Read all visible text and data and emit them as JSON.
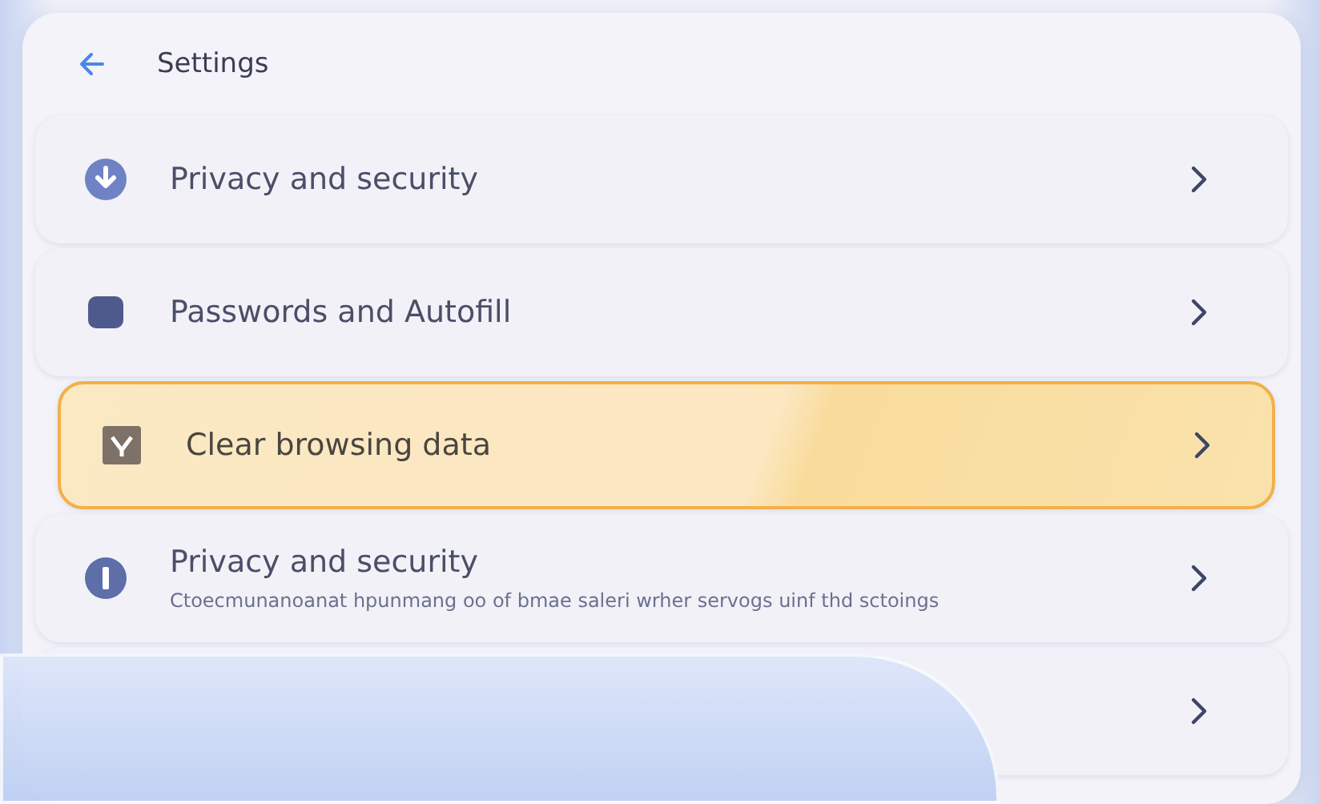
{
  "header": {
    "title": "Settings"
  },
  "items": [
    {
      "kind": "download",
      "label": "Privacy and security",
      "selected": false
    },
    {
      "kind": "square",
      "label": "Passwords and Autofill",
      "selected": false
    },
    {
      "kind": "broom",
      "label": "Clear browsing data",
      "selected": true
    },
    {
      "kind": "info",
      "label": "Privacy and security",
      "description": "Ctoecmunanoanat hpunmang oo of bmae saleri wrher servogs uinf thd sctoings",
      "selected": false
    },
    {
      "kind": "blank",
      "selected": false
    }
  ]
}
